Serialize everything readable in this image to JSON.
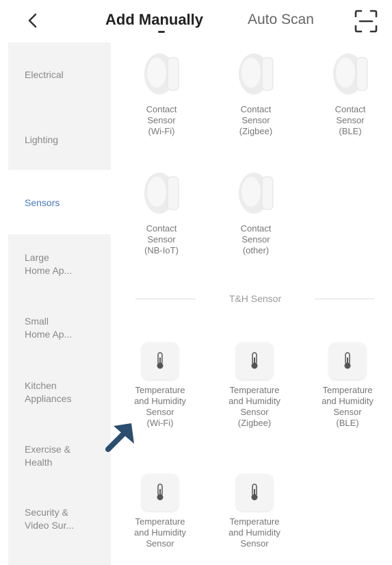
{
  "header": {
    "tab_add_manually": "Add Manually",
    "tab_auto_scan": "Auto Scan",
    "back_icon": "chevron-left-icon",
    "scan_icon": "scan-icon"
  },
  "sidebar": {
    "items": [
      {
        "label": "Electrical"
      },
      {
        "label": "Lighting"
      },
      {
        "label": "Sensors"
      },
      {
        "label": "Large\nHome Ap..."
      },
      {
        "label": "Small\nHome Ap..."
      },
      {
        "label": "Kitchen\nAppliances"
      },
      {
        "label": "Exercise &\nHealth"
      },
      {
        "label": "Security &\nVideo Sur..."
      }
    ],
    "active_index": 2
  },
  "devices": {
    "contact": [
      {
        "label": "Contact\nSensor\n(Wi-Fi)"
      },
      {
        "label": "Contact\nSensor\n(Zigbee)"
      },
      {
        "label": "Contact\nSensor\n(BLE)"
      },
      {
        "label": "Contact\nSensor\n(NB-IoT)"
      },
      {
        "label": "Contact\nSensor\n(other)"
      }
    ],
    "th_section_title": "T&H Sensor",
    "th": [
      {
        "label": "Temperature\nand Humidity\nSensor\n(Wi-Fi)"
      },
      {
        "label": "Temperature\nand Humidity\nSensor\n(Zigbee)"
      },
      {
        "label": "Temperature\nand Humidity\nSensor\n(BLE)"
      },
      {
        "label": "Temperature\nand Humidity\nSensor"
      },
      {
        "label": "Temperature\nand Humidity\nSensor"
      }
    ]
  },
  "colors": {
    "active": "#4a78c2",
    "pointer": "#2b4d6e"
  }
}
